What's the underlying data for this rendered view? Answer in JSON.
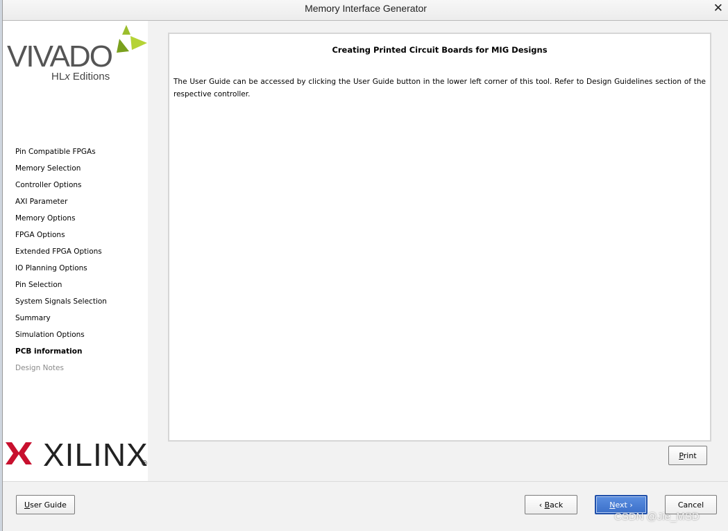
{
  "window": {
    "title": "Memory Interface Generator"
  },
  "sidebar": {
    "vivado_logo": {
      "word": "VIVADO",
      "sub_prefix": "HL",
      "sub_x": "x",
      "sub_suffix": " Editions"
    },
    "steps": [
      {
        "label": "Pin Compatible FPGAs",
        "state": "normal"
      },
      {
        "label": "Memory Selection",
        "state": "normal"
      },
      {
        "label": "Controller Options",
        "state": "normal"
      },
      {
        "label": "AXI Parameter",
        "state": "normal"
      },
      {
        "label": "Memory Options",
        "state": "normal"
      },
      {
        "label": "FPGA Options",
        "state": "normal"
      },
      {
        "label": "Extended FPGA Options",
        "state": "normal"
      },
      {
        "label": "IO Planning Options",
        "state": "normal"
      },
      {
        "label": "Pin Selection",
        "state": "normal"
      },
      {
        "label": "System Signals Selection",
        "state": "normal"
      },
      {
        "label": "Summary",
        "state": "normal"
      },
      {
        "label": "Simulation Options",
        "state": "normal"
      },
      {
        "label": "PCB information",
        "state": "active"
      },
      {
        "label": "Design Notes",
        "state": "disabled"
      }
    ],
    "xilinx_logo": {
      "word": "XILINX",
      "mark": "®"
    }
  },
  "content": {
    "heading": "Creating Printed Circuit Boards for MIG Designs",
    "body": "The User Guide can be accessed by clicking the User Guide button in the lower left corner of this tool. Refer to Design Guidelines section of the respective controller."
  },
  "buttons": {
    "print": {
      "mnemonic": "P",
      "rest": "rint"
    },
    "user_guide": {
      "mnemonic": "U",
      "rest": "ser Guide"
    },
    "back": {
      "prefix": "‹ ",
      "mnemonic": "B",
      "rest": "ack"
    },
    "next": {
      "mnemonic": "N",
      "rest": "ext ›"
    },
    "cancel": {
      "label": "Cancel"
    }
  },
  "watermark": "CSDN @Jie_MSD",
  "colors": {
    "vivado_green": "#9bbe2d",
    "xilinx_red": "#c8102e",
    "primary_button": "#3b6fc9"
  }
}
